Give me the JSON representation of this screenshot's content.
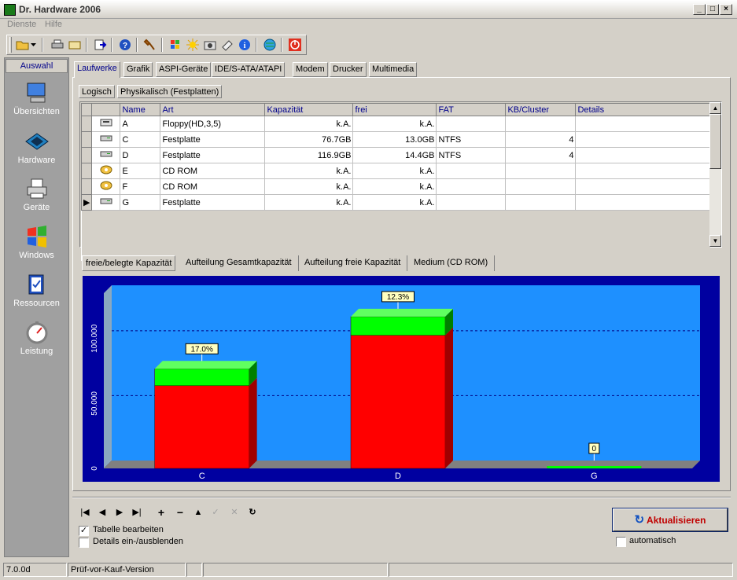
{
  "window": {
    "title": "Dr. Hardware 2006"
  },
  "menu": [
    {
      "label": "Dienste"
    },
    {
      "label": "Hilfe"
    }
  ],
  "toolbar_icons": [
    "folder-open-icon",
    "dropdown-arrow-icon",
    "printer-icon",
    "print-preview-icon",
    "export-icon",
    "help-icon",
    "tools-icon",
    "windows-icon",
    "sun-icon",
    "camera-icon",
    "notes-icon",
    "info-icon",
    "network-globe-icon",
    "power-icon"
  ],
  "sidebar": {
    "header": "Auswahl",
    "items": [
      {
        "label": "Übersichten",
        "icon": "computer-icon"
      },
      {
        "label": "Hardware",
        "icon": "chip-icon"
      },
      {
        "label": "Geräte",
        "icon": "printer-icon"
      },
      {
        "label": "Windows",
        "icon": "windows-flag-icon"
      },
      {
        "label": "Ressourcen",
        "icon": "checklist-icon"
      },
      {
        "label": "Leistung",
        "icon": "stopwatch-icon"
      }
    ]
  },
  "tabs": [
    {
      "label": "Laufwerke",
      "active": true
    },
    {
      "label": "Grafik"
    },
    {
      "label": "ASPI-Geräte"
    },
    {
      "label": "IDE/S-ATA/ATAPI"
    },
    {
      "label": "Modem"
    },
    {
      "label": "Drucker"
    },
    {
      "label": "Multimedia"
    }
  ],
  "subtabs": [
    {
      "label": "Logisch",
      "active": true
    },
    {
      "label": "Physikalisch (Festplatten)"
    }
  ],
  "table": {
    "columns": [
      "Name",
      "Art",
      "Kapazität",
      "frei",
      "FAT",
      "KB/Cluster",
      "Details"
    ],
    "rows": [
      {
        "icon": "floppy-drive-icon",
        "cells": [
          "A",
          "Floppy(HD,3,5)",
          "k.A.",
          "k.A.",
          "",
          "",
          ""
        ]
      },
      {
        "icon": "hard-drive-icon",
        "cells": [
          "C",
          "Festplatte",
          "76.7GB",
          "13.0GB",
          "NTFS",
          "4",
          ""
        ]
      },
      {
        "icon": "hard-drive-icon",
        "cells": [
          "D",
          "Festplatte",
          "116.9GB",
          "14.4GB",
          "NTFS",
          "4",
          ""
        ]
      },
      {
        "icon": "cd-rom-icon",
        "cells": [
          "E",
          "CD ROM",
          "k.A.",
          "k.A.",
          "",
          "",
          ""
        ]
      },
      {
        "icon": "cd-rom-icon",
        "cells": [
          "F",
          "CD ROM",
          "k.A.",
          "k.A.",
          "",
          "",
          ""
        ]
      },
      {
        "icon": "hard-drive-icon",
        "cells": [
          "G",
          "Festplatte",
          "k.A.",
          "k.A.",
          "",
          "",
          ""
        ],
        "current": true
      }
    ]
  },
  "chart_tabs": [
    {
      "label": "freie/belegte Kapazität",
      "active": true
    },
    {
      "label": "Aufteilung Gesamtkapazität"
    },
    {
      "label": "Aufteilung freie Kapazität"
    },
    {
      "label": "Medium (CD ROM)"
    }
  ],
  "chart_data": {
    "type": "bar",
    "stacked": true,
    "categories": [
      "C",
      "D",
      "G"
    ],
    "series": [
      {
        "values": [
          63.7,
          102.5,
          0
        ],
        "color": "#ff0000"
      },
      {
        "values": [
          13.0,
          14.4,
          0
        ],
        "color": "#00ff00"
      }
    ],
    "labels": [
      "17.0%",
      "12.3%",
      "0"
    ],
    "yticks": [
      "0",
      "50.000",
      "100.000"
    ],
    "ylim": [
      0,
      135
    ],
    "background": "#0000a0",
    "plot_color": "#1e90ff"
  },
  "nav_buttons": [
    "first-icon",
    "prev-icon",
    "next-icon",
    "last-icon",
    "add-icon",
    "remove-icon",
    "up-icon",
    "confirm-icon",
    "cancel-icon",
    "refresh-small-icon"
  ],
  "options": {
    "edit_table": {
      "label": "Tabelle bearbeiten",
      "checked": true
    },
    "details_toggle": {
      "label": "Details ein-/ausblenden",
      "checked": false
    },
    "auto": {
      "label": "automatisch",
      "checked": false
    }
  },
  "refresh_button": {
    "label": "Aktualisieren"
  },
  "status": {
    "version": "7.0.0d",
    "edition": "Prüf-vor-Kauf-Version"
  }
}
